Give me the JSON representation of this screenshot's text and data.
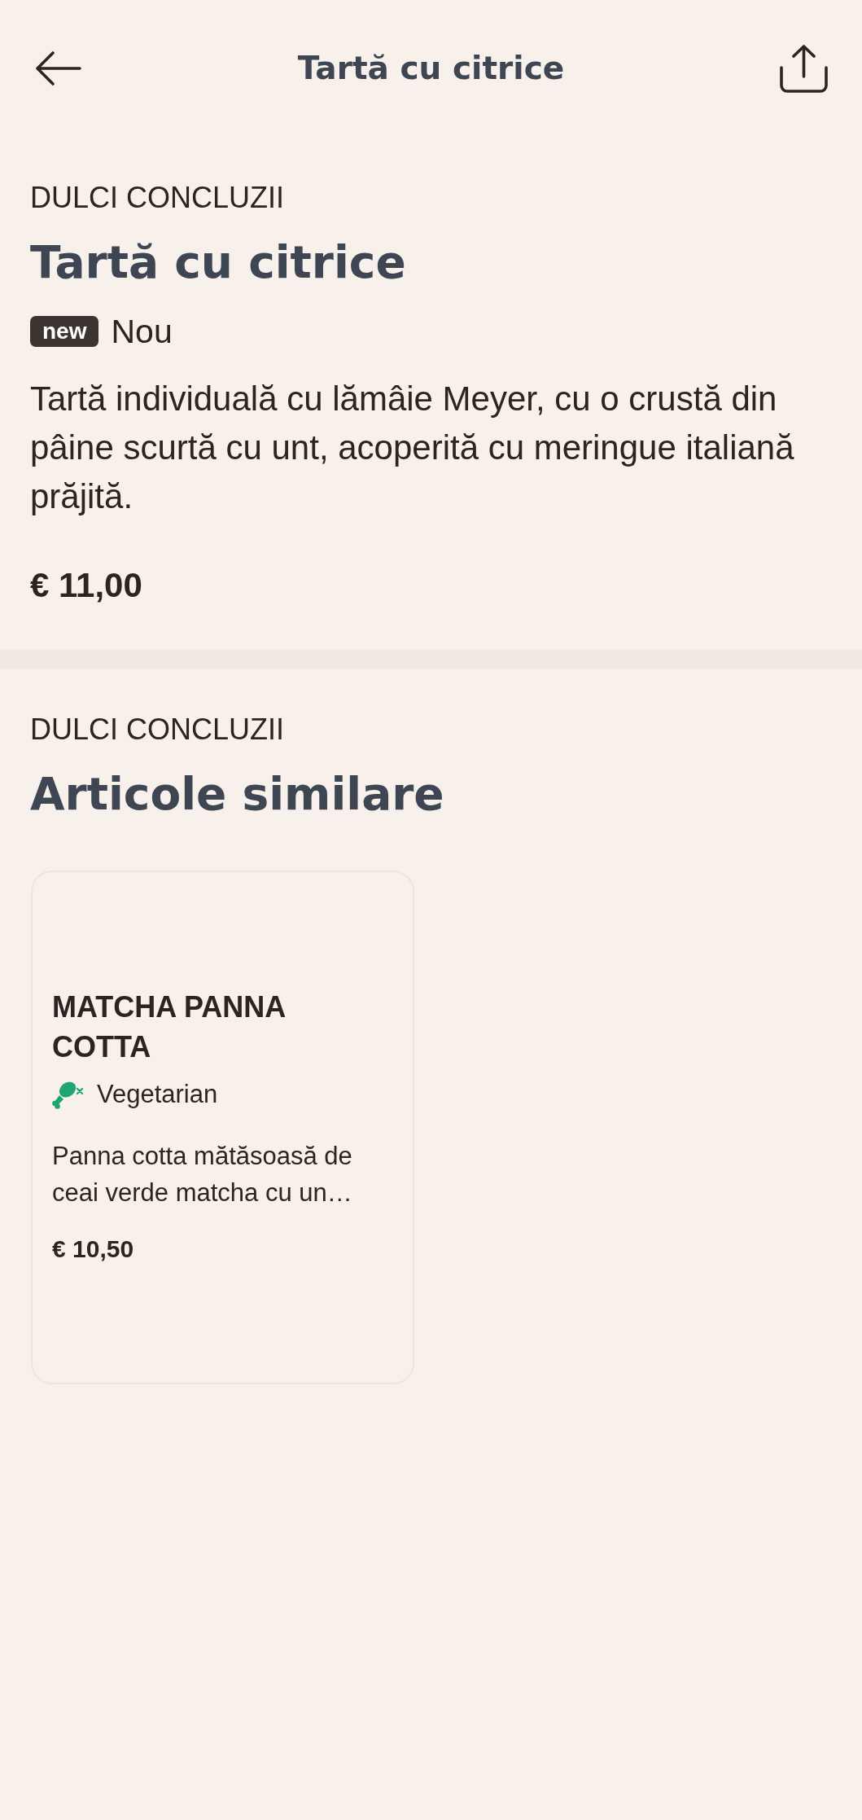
{
  "header": {
    "title": "Tartă cu citrice"
  },
  "product": {
    "category": "DULCI CONCLUZII",
    "name": "Tartă cu citrice",
    "badge": "new",
    "badge_label": "Nou",
    "description": "Tartă individuală cu lămâie Meyer, cu o crustă din pâine scurtă cu unt, acoperită cu meringue italiană prăjită.",
    "price": "€ 11,00"
  },
  "similar": {
    "category": "DULCI CONCLUZII",
    "title": "Articole similare",
    "items": [
      {
        "name": "MATCHA PANNA COTTA",
        "tags": [
          {
            "label": "Vegetarian"
          }
        ],
        "description": "Panna cotta mătăsoasă de ceai verde matcha cu un…",
        "price": "€ 10,50"
      }
    ]
  }
}
